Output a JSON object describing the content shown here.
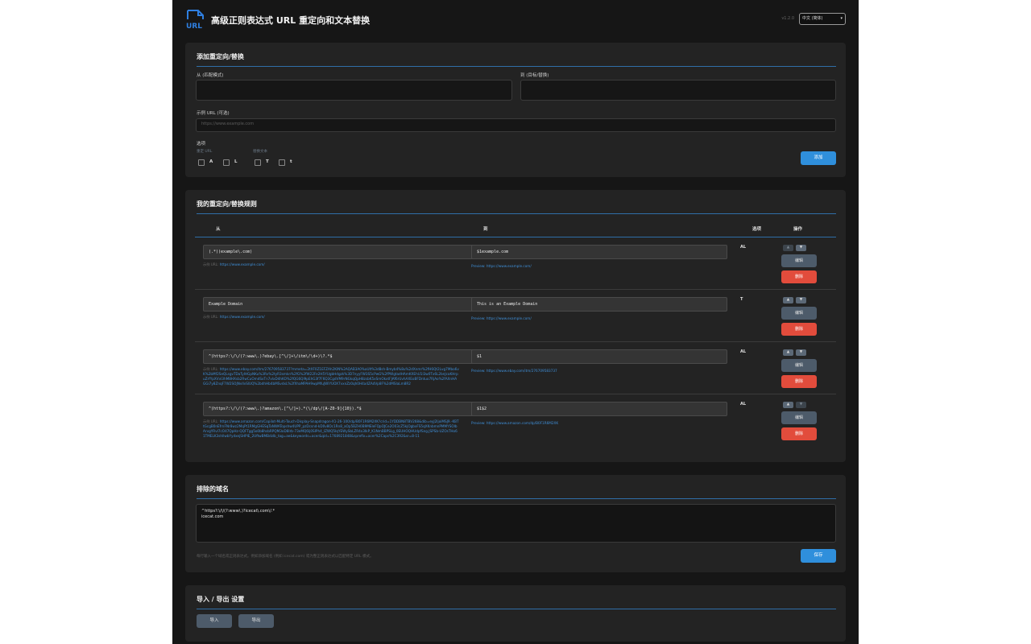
{
  "header": {
    "title": "高级正则表达式 URL 重定向和文本替换",
    "logo_text": "URL",
    "version": "v1.2.0",
    "language": "中文 (简体)"
  },
  "add_section": {
    "title": "添加重定向/替换",
    "from_label": "从 (匹配模式)",
    "to_label": "到 (目标/替换)",
    "from_value": "",
    "to_value": "",
    "example_label": "示例 URL (可选)",
    "example_placeholder": "https://www.example.com",
    "options_label": "选项",
    "redirect_url_label": "重定 URL",
    "replace_text_label": "替换文本",
    "checkboxes": [
      {
        "label": "A",
        "checked": false
      },
      {
        "label": "L",
        "checked": false
      },
      {
        "label": "T",
        "checked": false
      },
      {
        "label": "t",
        "checked": false
      }
    ],
    "add_button": "添加"
  },
  "rules_section": {
    "title": "我的重定向/替换规则",
    "columns": {
      "from": "从",
      "to": "到",
      "options": "选项",
      "actions": "操作"
    },
    "example_prefix": "示例 URL:",
    "preview_prefix": "Preview:",
    "edit_label": "编辑",
    "delete_label": "删除",
    "up_label": "▲",
    "down_label": "▼",
    "rules": [
      {
        "from": "(.*)(example\\.com)",
        "example": "https://www.example.com/",
        "to": "$1example.com",
        "preview": "https://www.example.com/",
        "options": "AL"
      },
      {
        "from": "Example Domain",
        "example": "https://www.example.com/",
        "to": "This is an Example Domain",
        "preview": "https://www.example.com/",
        "options": "T"
      },
      {
        "from": "^(https?:\\/\\/(?:www\\.)?ebay\\.[^\\/]+\\/itm\\/\\d+)\\?.*$",
        "example": "https://www.ebay.com/itm/276709583737?mmeta=2tXF0Z1EFZAh2KlN%2AQAB3A0%aUlt%3d8sh-Bmyb4%8u%2dXnmr%2fH6Qt2Lvg7Mbo6vK%2bMf2SeQLsgvTDaTyIHGpNKu%3Rv%2tyR3smkn%2fG%2fW22Fe2H5YUgbHdgzk%3D7nyyFW3S5cPwG%2fPWgtadHAmKXEhU1l3w0Tx6L2bnJcaKHrpuZrfYpXVvl3hM8HXsb2RwCuOmdSxTn7vlxD4hKO%2fQG6Ql9pEhG3f7F6Q3CgdVM9rNGkqQpH8zsbK5xSmOkxtFJAf6rUvhAXEoBFDntuo7RjAo%2fAXnHAGGi7y8ZnqF7W2SOJNvlIvSlUQ%2bdhHb4bMSvdxL%2fXhaMPAH9wpMfuJWlYUOX7vxnZz0qh0H4a4ZAdVp8F%2dMSIaLm8R2",
        "to": "$1",
        "preview": "https://www.ebay.com/itm/276709583737",
        "options": "AL"
      },
      {
        "from": "^(https?:\\/\\/(?:www\\.)?amazon\\.[^\\/]+).*(\\/dp\\/[A-Z0-9]{10}).*$",
        "example": "https://www.amazon.com/Copilot-Multi-Touch-Display-Snapdragon-X1-26-100/dp/B0F1R6M2XK?crid=1YDDBN8TBV268&dib=eyJ2IjoiMSJ9.-KBTtGcgB0nEfrnFNr8wz2MqPt1RMgGHESqTaNWATopshw4UPP_pzDcsnd-kD0v8Oc1Rn8_aOp5BZH0B9MEleFQpOJCe2O03cZ5kjOgbxFS5qXKnbmnPMMYSOlbArvgYRvl7cO47QpHz-QQFTgg5o0b8hsbRPQM3oD8Irb-73eMQ6Ij0SIPh4_IZWQ5IqYEWySbLZR4x3IkP_K1NmBBPSLg_0EUHOQHUdpfSng.JSPSb-UZOsTHo61TMELK3shllwbYydxejSHPlE_2UftwBMBdzlb_tag=ae&keywords=acer&qid=1768921848&sprefix=acer%2Caps%2C392&sr=8-11",
        "to": "$1$2",
        "preview": "https://www.amazon.com/dp/B0F1R6M2XK",
        "options": "AL"
      }
    ]
  },
  "excluded_section": {
    "title": "排除的域名",
    "domains": [
      "^https?:\\/\\/(?:www\\.)?icecat\\.com\\/.*",
      "icecat.com"
    ],
    "hint": "每行输入一个域名或正则表达式。例如添加域名 (例如 icecat.com) 或为整正则表达式以匹配特定 URL 模式。",
    "save_button": "保存"
  },
  "import_export": {
    "title": "导入 / 导出 设置",
    "import_button": "导入",
    "export_button": "导出"
  },
  "colors": {
    "accent": "#2f8fdc",
    "danger": "#e24c3c",
    "link": "#3f8fd8",
    "background": "#161616",
    "card": "#232323"
  }
}
